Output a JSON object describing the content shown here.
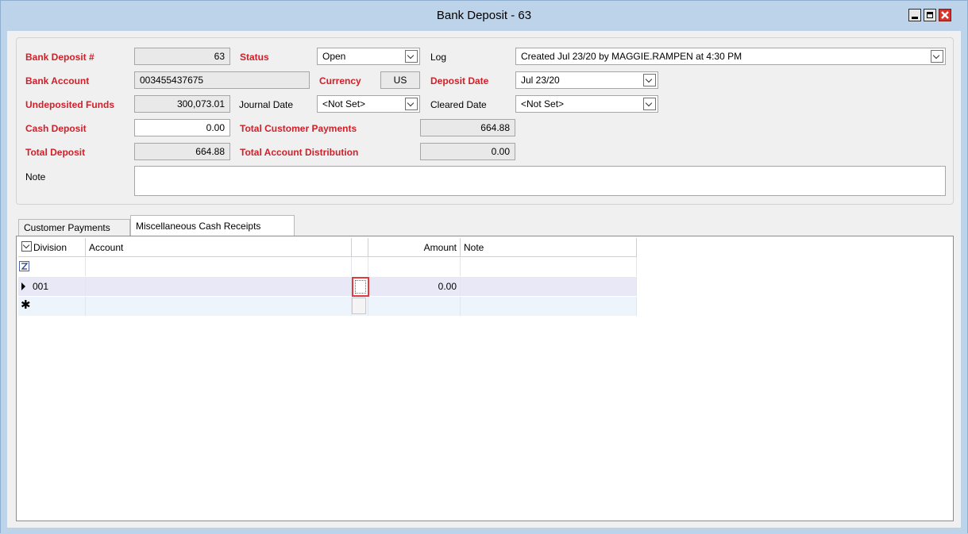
{
  "window": {
    "title": "Bank Deposit - 63"
  },
  "colors": {
    "required_label": "#d0202a",
    "title_bar": "#bdd3ea",
    "selected_row": "#e8e8f6",
    "new_row": "#eef4fb",
    "highlight_box": "#e33b3b"
  },
  "form": {
    "bank_deposit_no": {
      "label": "Bank Deposit #",
      "value": "63"
    },
    "status": {
      "label": "Status",
      "value": "Open"
    },
    "log": {
      "label": "Log",
      "value": "Created Jul 23/20 by MAGGIE.RAMPEN at 4:30 PM"
    },
    "bank_account": {
      "label": "Bank Account",
      "value": "003455437675"
    },
    "currency": {
      "label": "Currency",
      "value": "US"
    },
    "deposit_date": {
      "label": "Deposit Date",
      "value": "Jul 23/20"
    },
    "undeposited_funds": {
      "label": "Undeposited Funds",
      "value": "300,073.01"
    },
    "journal_date": {
      "label": "Journal Date",
      "value": "<Not Set>"
    },
    "cleared_date": {
      "label": "Cleared Date",
      "value": "<Not Set>"
    },
    "cash_deposit": {
      "label": "Cash Deposit",
      "value": "0.00"
    },
    "total_customer_payments": {
      "label": "Total Customer Payments",
      "value": "664.88"
    },
    "total_deposit": {
      "label": "Total Deposit",
      "value": "664.88"
    },
    "total_account_distribution": {
      "label": "Total Account Distribution",
      "value": "0.00"
    },
    "note": {
      "label": "Note",
      "value": ""
    }
  },
  "tabs": [
    {
      "label": "Customer Payments",
      "active": false
    },
    {
      "label": "Miscellaneous Cash Receipts",
      "active": true
    }
  ],
  "grid": {
    "columns": {
      "division": "Division",
      "account": "Account",
      "amount": "Amount",
      "note": "Note"
    },
    "filter_icon": "filter-icon",
    "current_row_icon": "triangle-right-icon",
    "new_row_icon": "asterisk-icon",
    "rows": [
      {
        "division": "001",
        "account": "",
        "amount": "0.00",
        "note": ""
      }
    ]
  }
}
